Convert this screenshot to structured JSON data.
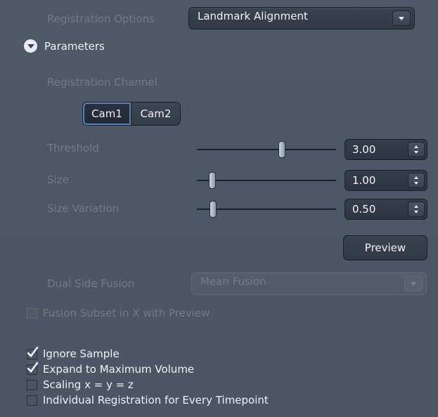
{
  "registration_options": {
    "label": "Registration Options",
    "selected": "Landmark Alignment"
  },
  "parameters": {
    "label": "Parameters",
    "expanded": true
  },
  "registration_channel": {
    "label": "Registration Channel",
    "options": [
      "Cam1",
      "Cam2"
    ],
    "selected": "Cam1"
  },
  "threshold": {
    "label": "Threshold",
    "value": "3.00",
    "slider_fraction": 0.62
  },
  "size": {
    "label": "Size",
    "value": "1.00",
    "slider_fraction": 0.0
  },
  "size_variation": {
    "label": "Size Variation",
    "value": "0.50",
    "slider_fraction": 0.06
  },
  "preview_button": "Preview",
  "dual_side_fusion": {
    "label": "Dual Side Fusion",
    "selected": "Mean Fusion",
    "enabled": false
  },
  "fusion_subset": {
    "label": "Fusion Subset in X with Preview",
    "checked": false,
    "enabled": false
  },
  "checkboxes": [
    {
      "label": "Ignore Sample",
      "checked": true
    },
    {
      "label": "Expand to Maximum Volume",
      "checked": true
    },
    {
      "label": "Scaling x = y = z",
      "checked": false
    },
    {
      "label": "Individual Registration for Every Timepoint",
      "checked": false
    }
  ],
  "colors": {
    "panel_bg": "#4d5866",
    "control_bg": "#323942",
    "active_outline": "#5d7fb1",
    "text": "#eef2f6",
    "text_dim": "#6f7b89"
  }
}
